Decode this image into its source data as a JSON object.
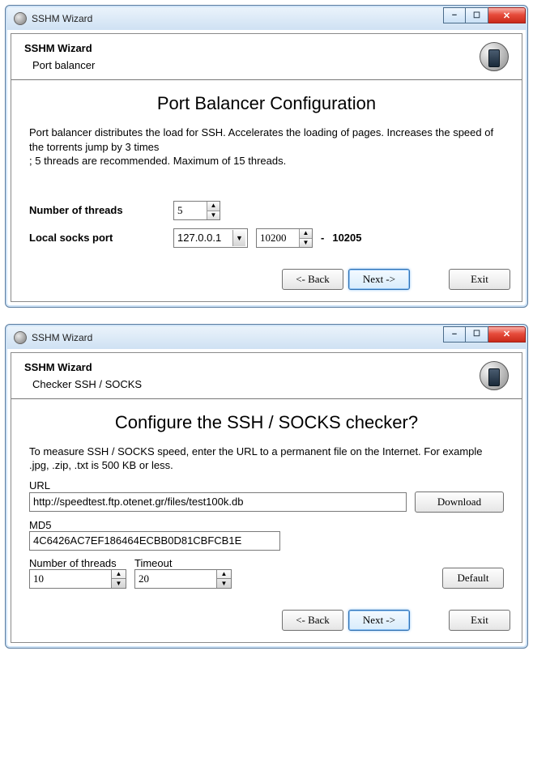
{
  "window1": {
    "title": "SSHM Wizard",
    "banner": {
      "title": "SSHM Wizard",
      "subtitle": "Port balancer"
    },
    "page_title": "Port Balancer Configuration",
    "desc1": "Port balancer distributes the load for SSH. Accelerates the loading of pages. Increases the speed of the torrents jump by 3 times",
    "desc2": "; 5 threads are recommended. Maximum of 15 threads.",
    "num_threads_label": "Number of threads",
    "num_threads_value": "5",
    "socks_label": "Local socks port",
    "socks_host": "127.0.0.1",
    "socks_port_start": "10200",
    "socks_dash": "-",
    "socks_port_end": "10205",
    "back": "<- Back",
    "next": "Next ->",
    "exit": "Exit"
  },
  "window2": {
    "title": "SSHM Wizard",
    "banner": {
      "title": "SSHM Wizard",
      "subtitle": "Checker SSH / SOCKS"
    },
    "page_title": "Configure the SSH / SOCKS checker?",
    "desc1": "To measure SSH / SOCKS speed, enter the URL to a permanent file on the Internet. For example .jpg, .zip, .txt is 500 KB or less.",
    "url_label": "URL",
    "url_value": "http://speedtest.ftp.otenet.gr/files/test100k.db",
    "download": "Download",
    "md5_label": "MD5",
    "md5_value": "4C6426AC7EF186464ECBB0D81CBFCB1E",
    "threads_label": "Number of threads",
    "threads_value": "10",
    "timeout_label": "Timeout",
    "timeout_value": "20",
    "default_btn": "Default",
    "back": "<- Back",
    "next": "Next ->",
    "exit": "Exit"
  }
}
